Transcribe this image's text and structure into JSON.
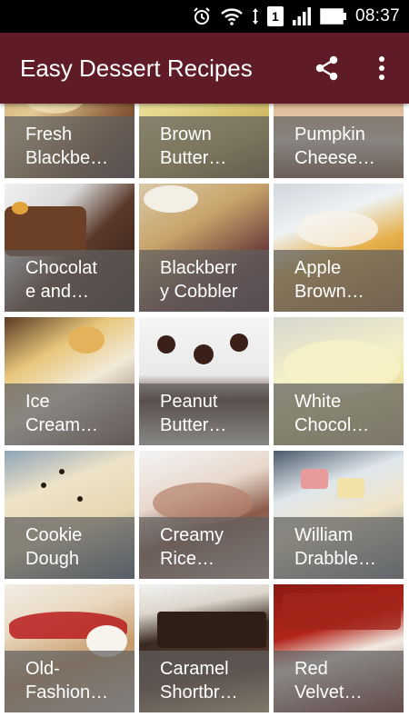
{
  "status_bar": {
    "time": "08:37",
    "sim_slot": "1",
    "icons": [
      "alarm-icon",
      "wifi-icon",
      "sim-icon",
      "signal-icon",
      "battery-icon"
    ]
  },
  "app_bar": {
    "title": "Easy Dessert Recipes",
    "background": "#5f1c26",
    "actions": [
      "share-icon",
      "more-vert-icon"
    ]
  },
  "recipes": [
    {
      "line1": "Fresh",
      "line2": "Blackbe…"
    },
    {
      "line1": "Brown",
      "line2": "Butter…"
    },
    {
      "line1": "Pumpkin",
      "line2": "Cheese…"
    },
    {
      "line1": "Chocolat",
      "line2": "e and…"
    },
    {
      "line1": "Blackberr",
      "line2": "y Cobbler"
    },
    {
      "line1": "Apple",
      "line2": "Brown…"
    },
    {
      "line1": "Ice",
      "line2": "Cream…"
    },
    {
      "line1": "Peanut",
      "line2": "Butter…"
    },
    {
      "line1": "White",
      "line2": "Chocol…"
    },
    {
      "line1": "Cookie",
      "line2": "Dough"
    },
    {
      "line1": "Creamy",
      "line2": "Rice…"
    },
    {
      "line1": "William",
      "line2": "Drabble…"
    },
    {
      "line1": "Old-",
      "line2": "Fashion…"
    },
    {
      "line1": "Caramel",
      "line2": "Shortbr…"
    },
    {
      "line1": "Red",
      "line2": "Velvet…"
    }
  ]
}
